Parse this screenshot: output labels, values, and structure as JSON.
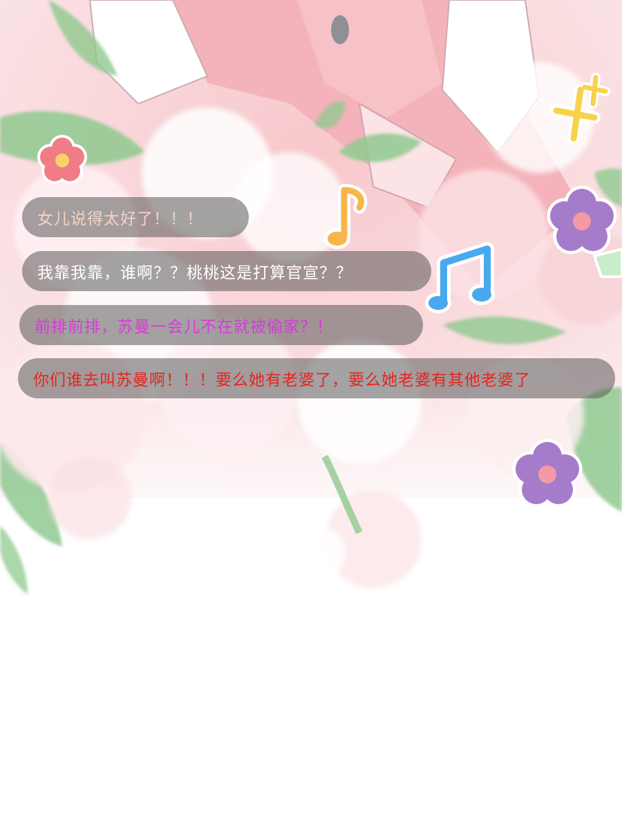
{
  "comments": [
    {
      "text": "女儿说得太好了！！！",
      "color": "#f3d3c6"
    },
    {
      "text": "我靠我靠，谁啊？？桃桃这是打算官宣？？",
      "color": "#ffffff"
    },
    {
      "text": "前排前排，苏曼一会儿不在就被偷家？！",
      "color": "#d63ad9"
    },
    {
      "text": "你们谁去叫苏曼啊！！！要么她有老婆了，要么她老婆有其他老婆了",
      "color": "#e8241e"
    }
  ],
  "colors": {
    "pink_bg": "#f6c4c8",
    "leaf_green": "#8fc98f",
    "note_orange": "#f8b54a",
    "note_blue": "#49a9ee",
    "flower_purple": "#a57cc9",
    "flower_red": "#f07c86",
    "sparkle_yellow": "#f7d24a"
  }
}
